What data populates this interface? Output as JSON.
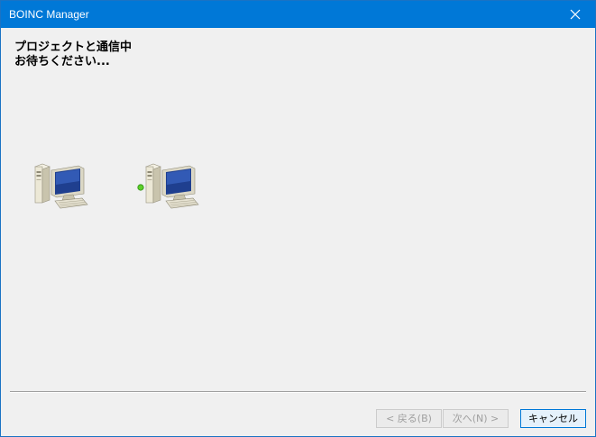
{
  "window": {
    "title": "BOINC Manager"
  },
  "dialog": {
    "heading_line1": "プロジェクトと通信中",
    "heading_line2": "お待ちください..."
  },
  "icons": {
    "local_computer": "computer-icon",
    "remote_computer": "computer-icon",
    "activity": "green-dot-icon"
  },
  "buttons": {
    "back_label": "< 戻る(B)",
    "next_label": "次へ(N) >",
    "cancel_label": "キャンセル"
  },
  "colors": {
    "titlebar": "#0078d7",
    "activity_dot": "#5ccf2a"
  }
}
